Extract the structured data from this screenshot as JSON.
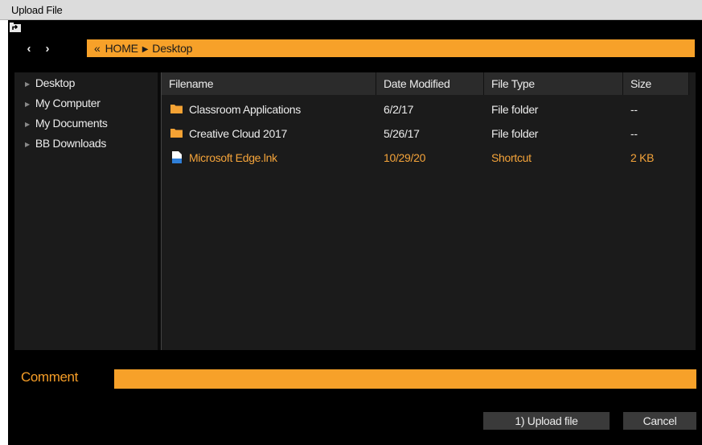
{
  "window": {
    "title": "Upload File"
  },
  "nav": {
    "back_glyph": "‹",
    "forward_glyph": "›"
  },
  "breadcrumb": {
    "prefix": "«",
    "items": [
      "HOME",
      "Desktop"
    ],
    "separator": "▶"
  },
  "sidebar": {
    "items": [
      {
        "label": "Desktop"
      },
      {
        "label": "My Computer"
      },
      {
        "label": "My Documents"
      },
      {
        "label": "BB Downloads"
      }
    ]
  },
  "filelist": {
    "columns": {
      "name": "Filename",
      "date": "Date Modified",
      "type": "File Type",
      "size": "Size"
    },
    "rows": [
      {
        "icon": "folder-icon",
        "name": "Classroom Applications",
        "date": "6/2/17",
        "type": "File folder",
        "size": "--",
        "selected": false
      },
      {
        "icon": "folder-icon",
        "name": "Creative Cloud 2017",
        "date": "5/26/17",
        "type": "File folder",
        "size": "--",
        "selected": false
      },
      {
        "icon": "file-icon",
        "name": "Microsoft Edge.lnk",
        "date": "10/29/20",
        "type": "Shortcut",
        "size": "2 KB",
        "selected": true
      }
    ]
  },
  "comment": {
    "label": "Comment",
    "value": "",
    "placeholder": ""
  },
  "buttons": {
    "upload_label": "1) Upload file",
    "cancel_label": "Cancel"
  },
  "colors": {
    "accent": "#f7a129",
    "selected_text": "#f5a43a",
    "background": "#000000",
    "panel": "#1b1b1b",
    "header": "#2b2b2b",
    "folder": "#f4a234"
  }
}
